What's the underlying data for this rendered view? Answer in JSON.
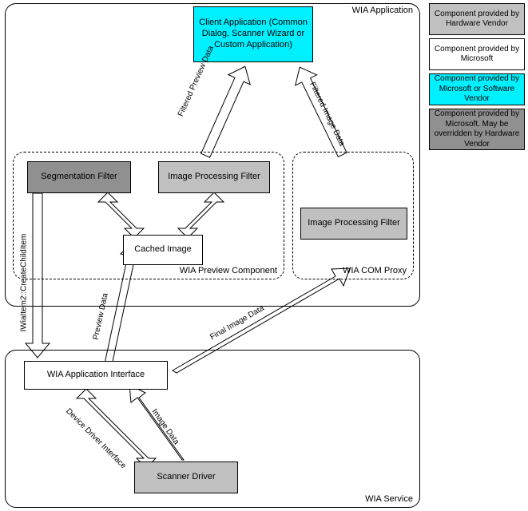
{
  "diagram": {
    "regions": {
      "wia_application": "WIA Application",
      "wia_preview_component": "WIA Preview Component",
      "wia_com_proxy": "WIA COM Proxy",
      "wia_service": "WIA Service"
    },
    "nodes": {
      "client_app": "Client Application (Common Dialog, Scanner Wizard or Custom Application)",
      "segmentation_filter": "Segmentation Filter",
      "image_processing_filter_preview": "Image Processing Filter",
      "cached_image": "Cached Image",
      "image_processing_filter_proxy": "Image Processing Filter",
      "wia_application_interface": "WIA Application Interface",
      "scanner_driver": "Scanner Driver"
    },
    "arrows": {
      "filtered_preview_data": "Filtered Preview Data",
      "filtered_image_data": "Filtered Image Data",
      "create_child_item": "IWiaItem2::CreateChildItem",
      "preview_data": "Preview Data",
      "final_image_data": "Final Image Data",
      "device_driver_interface": "Device Driver Interface",
      "image_data": "Image Data"
    },
    "legend": {
      "hw_vendor": "Component provided by Hardware Vendor",
      "microsoft": "Component provided by Microsoft",
      "ms_or_sw_vendor": "Component provided by Microsoft or Software Vendor",
      "ms_overridable": "Component provided by Microsoft. May be overridden by Hardware Vendor"
    }
  }
}
